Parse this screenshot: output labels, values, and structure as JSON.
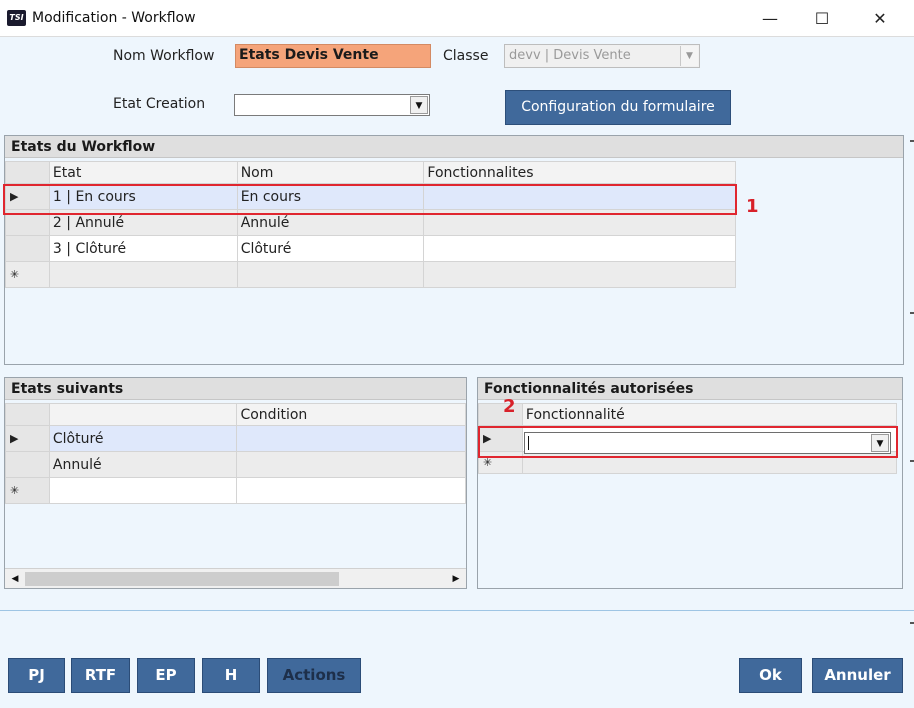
{
  "window": {
    "logo_text": "TSI",
    "title": "Modification - Workflow",
    "minimize": "—",
    "maximize": "☐",
    "close": "✕"
  },
  "form": {
    "nom_label": "Nom Workflow",
    "nom_value": "Etats Devis Vente",
    "classe_label": "Classe",
    "classe_value": "devv | Devis Vente",
    "etat_creation_label": "Etat Creation",
    "etat_creation_value": "",
    "config_button": "Configuration du formulaire"
  },
  "etats_workflow": {
    "title": "Etats du Workflow",
    "columns": [
      "Etat",
      "Nom",
      "Fonctionnalites"
    ],
    "rows": [
      {
        "etat": "1 | En cours",
        "nom": "En cours",
        "fonctionnalites": ""
      },
      {
        "etat": "2 | Annulé",
        "nom": "Annulé",
        "fonctionnalites": ""
      },
      {
        "etat": "3 | Clôturé",
        "nom": "Clôturé",
        "fonctionnalites": ""
      }
    ],
    "current_marker": "▶",
    "new_marker": "✳"
  },
  "etats_suivants": {
    "title": "Etats suivants",
    "columns": [
      "",
      "Condition"
    ],
    "rows": [
      {
        "etat": "Clôturé",
        "condition": ""
      },
      {
        "etat": "Annulé",
        "condition": ""
      }
    ],
    "current_marker": "▶",
    "new_marker": "✳"
  },
  "fonctionnalites": {
    "title": "Fonctionnalités autorisées",
    "column": "Fonctionnalité",
    "current_value": "",
    "current_marker": "▶",
    "new_marker": "✳"
  },
  "annotations": {
    "one": "1",
    "two": "2"
  },
  "scroll": {
    "left_arrow": "◀",
    "right_arrow": "▶"
  },
  "combo_arrow": "▼",
  "buttons": {
    "pj": "PJ",
    "rtf": "RTF",
    "ep": "EP",
    "h": "H",
    "actions": "Actions",
    "ok": "Ok",
    "annuler": "Annuler"
  },
  "colors": {
    "accent_button": "#40699b",
    "highlight_input": "#f5a47a",
    "annotation_red": "#e0262f",
    "background": "#eef6fd"
  }
}
